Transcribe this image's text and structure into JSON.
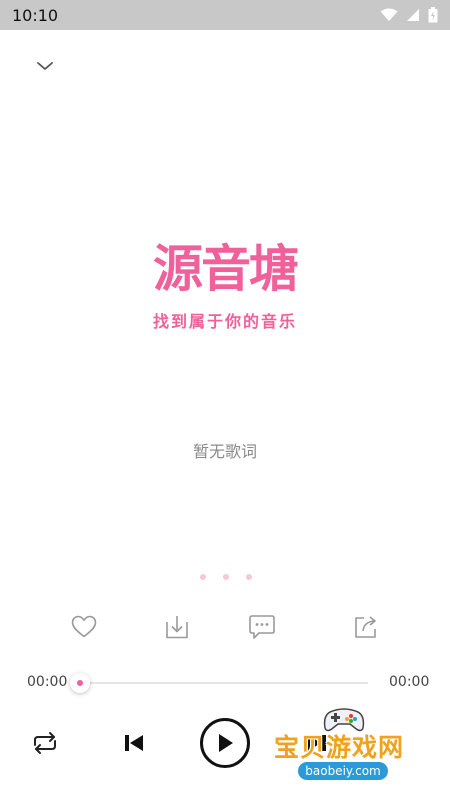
{
  "status_bar": {
    "time": "10:10"
  },
  "logo": {
    "title": "源音塘",
    "tagline": "找到属于你的音乐"
  },
  "lyrics": {
    "empty_text": "暂无歌词"
  },
  "pager": {
    "pages": 3
  },
  "player": {
    "current_time": "00:00",
    "total_time": "00:00",
    "progress": 0
  },
  "icons": {
    "collapse": "chevron-down-icon",
    "favorite": "heart-icon",
    "download": "download-icon",
    "comment": "comment-icon",
    "share": "share-icon",
    "repeat": "repeat-icon",
    "previous": "skip-previous-icon",
    "play": "play-icon",
    "next": "skip-next-icon"
  },
  "colors": {
    "accent": "#f0609a",
    "status_bar": "#c8c8c8",
    "watermark": "#f0a21e"
  },
  "watermark": {
    "text": "宝贝游戏网",
    "url": "baobeiy.com"
  }
}
